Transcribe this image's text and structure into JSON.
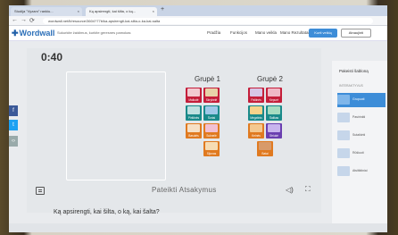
{
  "browser": {
    "tabs": [
      {
        "label": "Studija \"Vyzam\" rankiu...",
        "close": "×"
      },
      {
        "label": "Ką apsirengti, kai šilta, o ką...",
        "close": "×"
      }
    ],
    "new_tab": "+",
    "url": "wordwall.net/lt/resource/3604?77b/ka-apsirengti-kai-silta-o-ka-kai-salta"
  },
  "header": {
    "logo": "Wordwall",
    "subtitle": "Sukurkite žaidimus, kurkite geresnes pamokas",
    "nav": [
      "Pradžia",
      "Funkcijos",
      "Mano veikla",
      "Mano Rezultatai"
    ],
    "create_button": "Kurti veiklą",
    "upgrade_button": "Atnaujinti"
  },
  "activity": {
    "timer": "0:40",
    "group1": "Grupė 1",
    "group2": "Grupė 2",
    "cards": [
      {
        "label": "Maikutė",
        "color": "#c41e3a"
      },
      {
        "label": "Skrybelė",
        "color": "#c41e3a"
      },
      {
        "label": "Paltinės",
        "color": "#c41e3a"
      },
      {
        "label": "Kepurė",
        "color": "#c41e3a"
      },
      {
        "label": "Pirštinės",
        "color": "#1a8a8a"
      },
      {
        "label": "Šortai",
        "color": "#1a8a8a"
      },
      {
        "label": "Megztinis",
        "color": "#1a8a8a"
      },
      {
        "label": "Šalikas",
        "color": "#1a8a8a"
      },
      {
        "label": "Basutės",
        "color": "#e07a20"
      },
      {
        "label": "Suknelė",
        "color": "#e07a20"
      },
      {
        "label": "Kelnės",
        "color": "#e07a20"
      },
      {
        "label": "Striukė",
        "color": "#6a3fb0"
      },
      {
        "label": "Sijonas",
        "color": "#e07a20"
      },
      {
        "label": "Batai",
        "color": "#e07a20"
      }
    ],
    "submit": "Pateikti Atsakymus",
    "question": "Ką apsirengti, kai šilta, o ką, kai šalta?"
  },
  "sidebar": {
    "title": "Pakeisti šabloną",
    "subtitle": "INTERAKTYVUS",
    "items": [
      "Grupuoti",
      "Pasirinkti",
      "Sutaikinti",
      "Rūšiuoti",
      "Atsitiktiniai"
    ]
  }
}
